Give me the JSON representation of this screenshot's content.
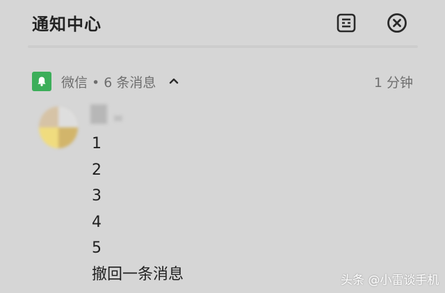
{
  "header": {
    "title": "通知中心",
    "settings_icon": "notification-settings-icon",
    "clear_icon": "close-circle-icon"
  },
  "group": {
    "app_icon": "bell-icon",
    "app_icon_color": "#3cae5a",
    "title": "微信 • 6 条消息",
    "expand_icon": "chevron-up-icon",
    "time": "1 分钟"
  },
  "notification": {
    "avatar_icon": "avatar",
    "messages": [
      "1",
      "2",
      "3",
      "4",
      "5",
      "撤回一条消息"
    ]
  },
  "watermark": "头条 @小雷谈手机"
}
